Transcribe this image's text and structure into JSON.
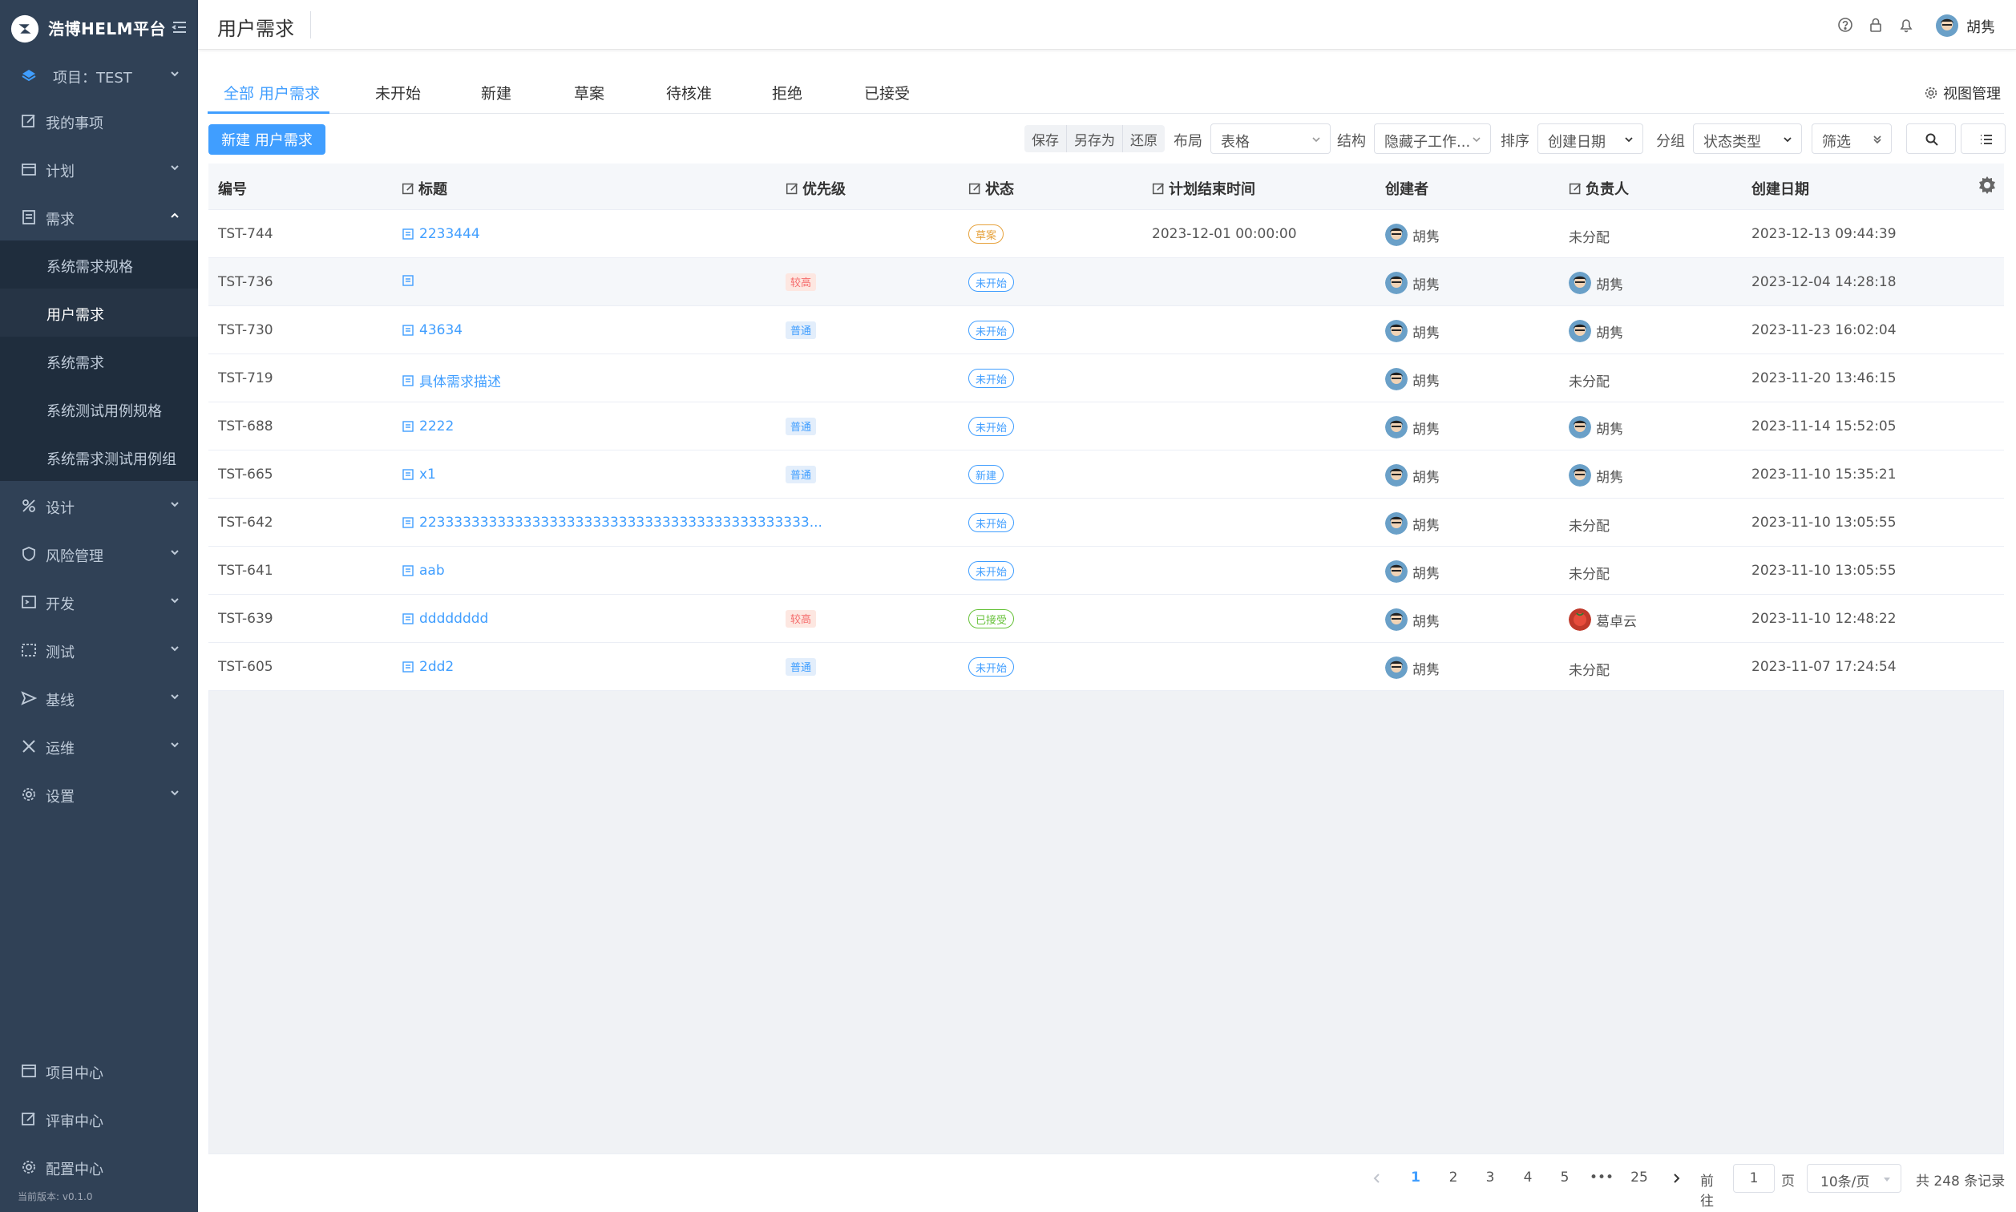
{
  "app": {
    "brand": "浩博HELM平台",
    "version": "当前版本: v0.1.0"
  },
  "sidebar": {
    "project": "项目：TEST",
    "items": [
      {
        "label": "我的事项",
        "icon": "edit-icon"
      },
      {
        "label": "计划",
        "icon": "calendar-icon"
      },
      {
        "label": "需求",
        "icon": "requirement-icon"
      },
      {
        "label": "设计",
        "icon": "design-icon"
      },
      {
        "label": "风险管理",
        "icon": "shield-icon"
      },
      {
        "label": "开发",
        "icon": "code-icon"
      },
      {
        "label": "测试",
        "icon": "test-icon"
      },
      {
        "label": "基线",
        "icon": "send-icon"
      },
      {
        "label": "运维",
        "icon": "tools-icon"
      },
      {
        "label": "设置",
        "icon": "gear-icon"
      }
    ],
    "sub_items": [
      "系统需求规格",
      "用户需求",
      "系统需求",
      "系统测试用例规格",
      "系统需求测试用例组"
    ],
    "bottom": [
      "项目中心",
      "评审中心",
      "配置中心"
    ]
  },
  "header": {
    "title": "用户需求",
    "user": "胡隽"
  },
  "tabs": [
    "全部 用户需求",
    "未开始",
    "新建",
    "草案",
    "待核准",
    "拒绝",
    "已接受"
  ],
  "view_manage": "视图管理",
  "toolbar": {
    "new_button": "新建 用户需求",
    "save": "保存",
    "save_as": "另存为",
    "restore": "还原",
    "layout_label": "布局",
    "layout_value": "表格",
    "structure_label": "结构",
    "structure_value": "隐藏子工作...",
    "sort_label": "排序",
    "sort_value": "创建日期",
    "group_label": "分组",
    "group_value": "状态类型",
    "filter": "筛选"
  },
  "table": {
    "columns": [
      "编号",
      "标题",
      "优先级",
      "状态",
      "计划结束时间",
      "创建者",
      "负责人",
      "创建日期"
    ],
    "rows": [
      {
        "id": "TST-744",
        "title": "2233444",
        "priority": "",
        "status": "草案",
        "end": "2023-12-01 00:00:00",
        "creator": "胡隽",
        "owner": "未分配",
        "created": "2023-12-13 09:44:39"
      },
      {
        "id": "TST-736",
        "title": "",
        "priority": "较高",
        "status": "未开始",
        "end": "",
        "creator": "胡隽",
        "owner": "胡隽",
        "created": "2023-12-04 14:28:18"
      },
      {
        "id": "TST-730",
        "title": "43634",
        "priority": "普通",
        "status": "未开始",
        "end": "",
        "creator": "胡隽",
        "owner": "胡隽",
        "created": "2023-11-23 16:02:04"
      },
      {
        "id": "TST-719",
        "title": "具体需求描述",
        "priority": "",
        "status": "未开始",
        "end": "",
        "creator": "胡隽",
        "owner": "未分配",
        "created": "2023-11-20 13:46:15"
      },
      {
        "id": "TST-688",
        "title": "2222",
        "priority": "普通",
        "status": "未开始",
        "end": "",
        "creator": "胡隽",
        "owner": "胡隽",
        "created": "2023-11-14 15:52:05"
      },
      {
        "id": "TST-665",
        "title": "x1",
        "priority": "普通",
        "status": "新建",
        "end": "",
        "creator": "胡隽",
        "owner": "胡隽",
        "created": "2023-11-10 15:35:21"
      },
      {
        "id": "TST-642",
        "title": "223333333333333333333333333333333333333333333...",
        "priority": "",
        "status": "未开始",
        "end": "",
        "creator": "胡隽",
        "owner": "未分配",
        "created": "2023-11-10 13:05:55"
      },
      {
        "id": "TST-641",
        "title": "aab",
        "priority": "",
        "status": "未开始",
        "end": "",
        "creator": "胡隽",
        "owner": "未分配",
        "created": "2023-11-10 13:05:55"
      },
      {
        "id": "TST-639",
        "title": "dddddddd",
        "priority": "较高",
        "status": "已接受",
        "end": "",
        "creator": "胡隽",
        "owner": "葛卓云",
        "created": "2023-11-10 12:48:22"
      },
      {
        "id": "TST-605",
        "title": "2dd2",
        "priority": "普通",
        "status": "未开始",
        "end": "",
        "creator": "胡隽",
        "owner": "未分配",
        "created": "2023-11-07 17:24:54"
      }
    ]
  },
  "pagination": {
    "pages": [
      "1",
      "2",
      "3",
      "4",
      "5",
      "•••",
      "25"
    ],
    "current": "1",
    "goto_label": "前往",
    "goto_value": "1",
    "page_unit": "页",
    "page_size": "10条/页",
    "total": "共 248 条记录"
  },
  "colors": {
    "sidebar_bg": "#304156",
    "accent": "#409eff",
    "high": "#f56c6c",
    "accepted": "#67c23a",
    "draft": "#e6a23c"
  }
}
